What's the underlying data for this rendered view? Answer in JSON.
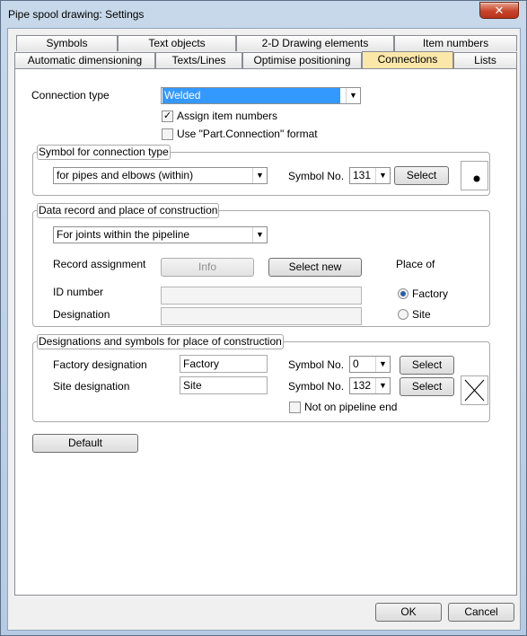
{
  "window": {
    "title": "Pipe spool drawing: Settings",
    "close_glyph": "✕"
  },
  "tabs_row1": [
    "Symbols",
    "Text objects",
    "2-D Drawing elements",
    "Item numbers"
  ],
  "tabs_row2": [
    "Automatic dimensioning",
    "Texts/Lines",
    "Optimise positioning",
    "Connections",
    "Lists"
  ],
  "active_tab": "Connections",
  "connection": {
    "label": "Connection type",
    "value": "Welded",
    "assign_item_numbers": {
      "label": "Assign item numbers",
      "checked": true
    },
    "use_format": {
      "label": "Use \"Part.Connection\" format",
      "checked": false
    }
  },
  "symbol_group": {
    "title": "Symbol for connection type",
    "combo_value": "for pipes and elbows (within)",
    "symbol_no_label": "Symbol No.",
    "symbol_no_value": "131",
    "select_label": "Select",
    "preview_icon": "weld-dot-icon"
  },
  "data_group": {
    "title": "Data record and place of construction",
    "combo_value": "For joints within the pipeline",
    "record_assignment_label": "Record assignment",
    "info_label": "Info",
    "select_new_label": "Select new",
    "id_number_label": "ID number",
    "id_number_value": "",
    "designation_label": "Designation",
    "designation_value": "",
    "place_of_label": "Place of",
    "factory_label": "Factory",
    "site_label": "Site",
    "place_selected": "Factory"
  },
  "designations_group": {
    "title": "Designations and symbols for place of construction",
    "factory_label": "Factory designation",
    "factory_value": "Factory",
    "site_label": "Site designation",
    "site_value": "Site",
    "symbol_no_label": "Symbol No.",
    "factory_symbol_no": "0",
    "site_symbol_no": "132",
    "select_label": "Select",
    "not_on_end": {
      "label": "Not on pipeline end",
      "checked": false
    },
    "preview_icon": "cross-symbol-icon"
  },
  "default_button": "Default",
  "ok_button": "OK",
  "cancel_button": "Cancel",
  "colors": {
    "active_tab": "#fbe7a8",
    "selection": "#3399ff",
    "close_button": "#c7442a"
  }
}
